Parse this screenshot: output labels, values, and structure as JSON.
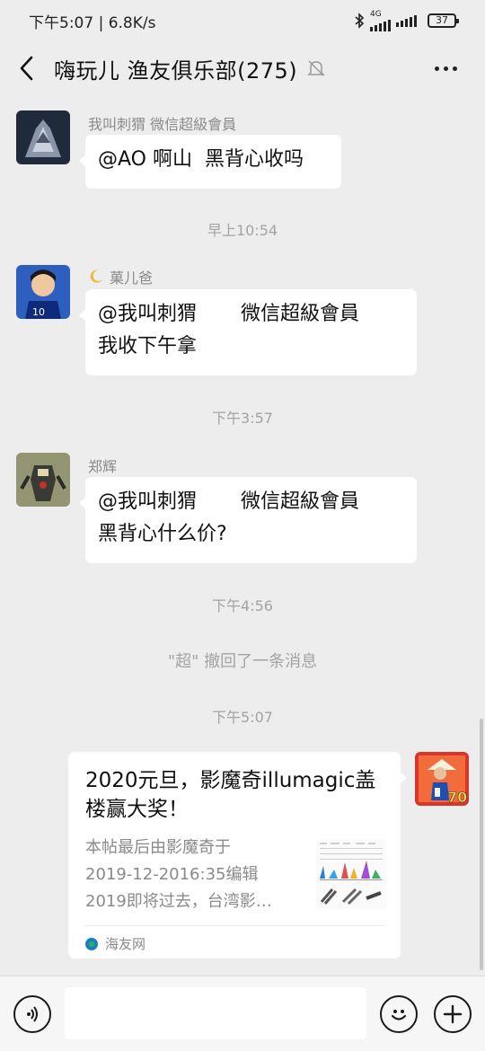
{
  "status_bar": {
    "time_speed": "下午5:07 | 6.8K/s",
    "network": "4G",
    "battery": "37"
  },
  "header": {
    "title": "嗨玩儿 渔友俱乐部(275)"
  },
  "messages": [
    {
      "sender": "我叫刺猬    微信超級會員",
      "text": "@AO 啊山  黑背心收吗"
    },
    {
      "time": "早上10:54"
    },
    {
      "sender": "菓儿爸",
      "text": "@我叫刺猬       微信超級會員\n我收下午拿"
    },
    {
      "time": "下午3:57"
    },
    {
      "sender": "郑辉",
      "text": "@我叫刺猬       微信超級會員\n黑背心什么价?"
    },
    {
      "time": "下午4:56"
    },
    {
      "system": "\"超\" 撤回了一条消息"
    },
    {
      "time": "下午5:07"
    },
    {
      "card": {
        "title": "2020元旦，影魔奇illumagic盖楼赢大奖！",
        "desc": [
          "本帖最后由影魔奇于",
          "2019-12-2016:35编辑",
          "2019即将过去，台湾影…"
        ],
        "source": "海友网"
      }
    }
  ],
  "avatars": {
    "self_badge": "70"
  },
  "colors": {
    "background": "#ededed",
    "bubble": "#ffffff",
    "meta_text": "#a3a3a3",
    "card_source_icon": "#1b7fc4"
  },
  "icons": [
    "back-chevron",
    "mute-bell",
    "more-dots",
    "voice",
    "emoji",
    "plus"
  ]
}
